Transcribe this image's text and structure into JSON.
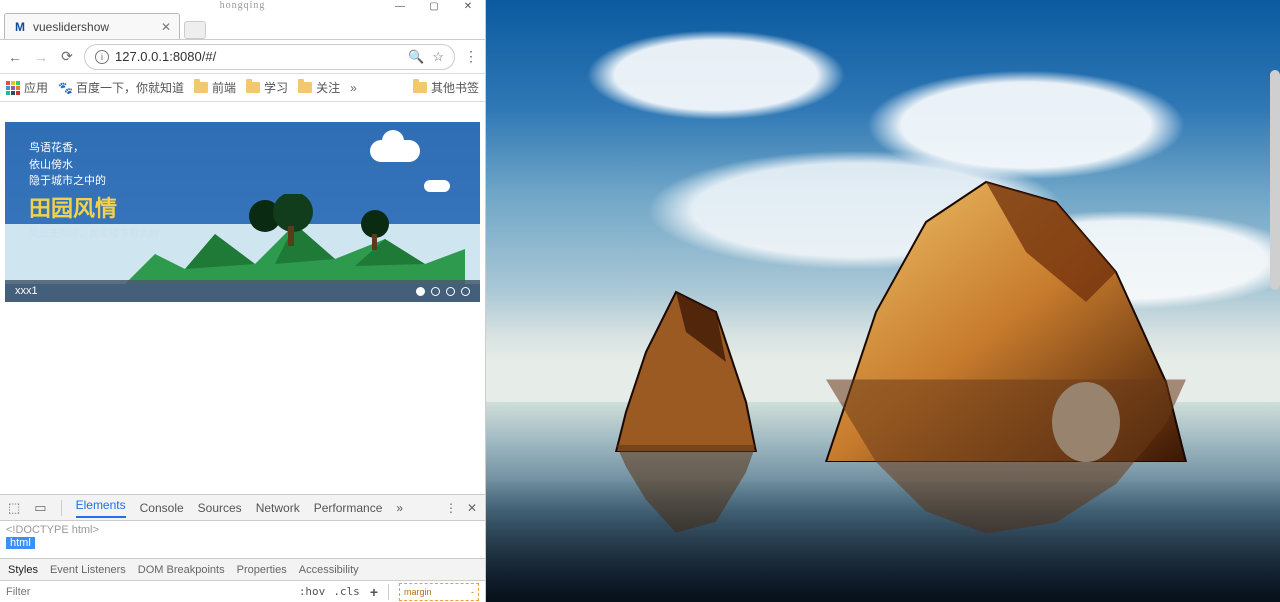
{
  "window": {
    "user_label": "hongqing"
  },
  "browser": {
    "tab_title": "vueslidershow",
    "url": "127.0.0.1:8080/#/",
    "bookmarks": {
      "apps": "应用",
      "baidu": "百度一下，你就知道",
      "frontend": "前端",
      "study": "学习",
      "follow": "关注",
      "overflow": "»",
      "other": "其他书签"
    }
  },
  "slide": {
    "line1": "鸟语花香，",
    "line2": "依山傍水",
    "line3": "隐于城市之中的",
    "title": "田园风情",
    "subtitle": "风景无限好，我家楼下有大树",
    "caption": "xxx1"
  },
  "devtools": {
    "tabs": {
      "elements": "Elements",
      "console": "Console",
      "sources": "Sources",
      "network": "Network",
      "performance": "Performance",
      "more": "»"
    },
    "doctype": "<!DOCTYPE html>",
    "root_tag": "html",
    "subtabs": {
      "styles": "Styles",
      "listeners": "Event Listeners",
      "dom": "DOM Breakpoints",
      "props": "Properties",
      "a11y": "Accessibility"
    },
    "filter_placeholder": "Filter",
    "hov": ":hov",
    "cls": ".cls",
    "box_label": "margin",
    "box_dash": "-"
  }
}
